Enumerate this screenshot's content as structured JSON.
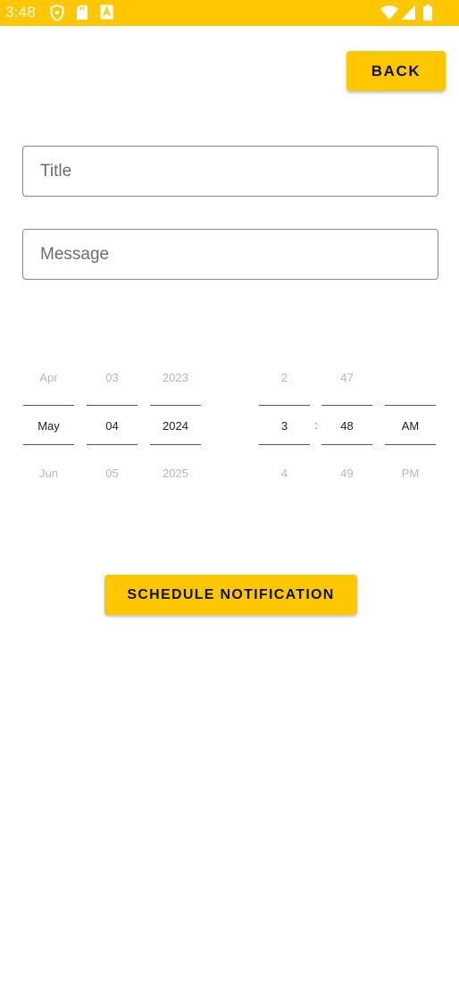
{
  "status_bar": {
    "time": "3:48",
    "background_color": "#FFC700",
    "left_icons": [
      "shield-icon",
      "sd-card-icon",
      "font-a-icon"
    ],
    "right_icons": [
      "wifi-icon",
      "cellular-signal-icon",
      "battery-icon"
    ]
  },
  "header": {
    "back_label": "BACK"
  },
  "form": {
    "title": {
      "placeholder": "Title",
      "value": ""
    },
    "message": {
      "placeholder": "Message",
      "value": ""
    }
  },
  "date_picker": {
    "month": {
      "prev": "Apr",
      "current": "May",
      "next": "Jun"
    },
    "day": {
      "prev": "03",
      "current": "04",
      "next": "05"
    },
    "year": {
      "prev": "2023",
      "current": "2024",
      "next": "2025"
    }
  },
  "time_picker": {
    "hour": {
      "prev": "2",
      "current": "3",
      "next": "4"
    },
    "separator": ":",
    "minute": {
      "prev": "47",
      "current": "48",
      "next": "49"
    },
    "ampm": {
      "prev": "",
      "current": "AM",
      "next": "PM"
    }
  },
  "actions": {
    "schedule_label": "SCHEDULE NOTIFICATION"
  },
  "colors": {
    "accent": "#FFC700",
    "text_dark": "#111111",
    "border": "#8a8a8a"
  }
}
